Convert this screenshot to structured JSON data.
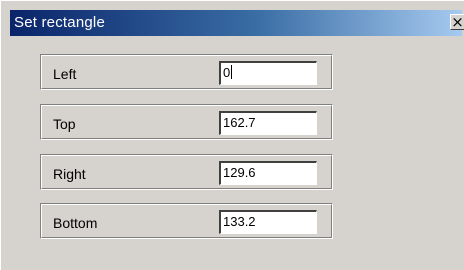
{
  "dialog": {
    "title": "Set rectangle",
    "close_glyph": "×"
  },
  "fields": [
    {
      "label": "Left",
      "value": "0",
      "focused": true
    },
    {
      "label": "Top",
      "value": "162.7"
    },
    {
      "label": "Right",
      "value": "129.6"
    },
    {
      "label": "Bottom",
      "value": "133.2"
    }
  ],
  "colors": {
    "title_bar_start": "#0a246a",
    "title_bar_end": "#a6caf0",
    "dialog_face": "#d6d3ce"
  }
}
